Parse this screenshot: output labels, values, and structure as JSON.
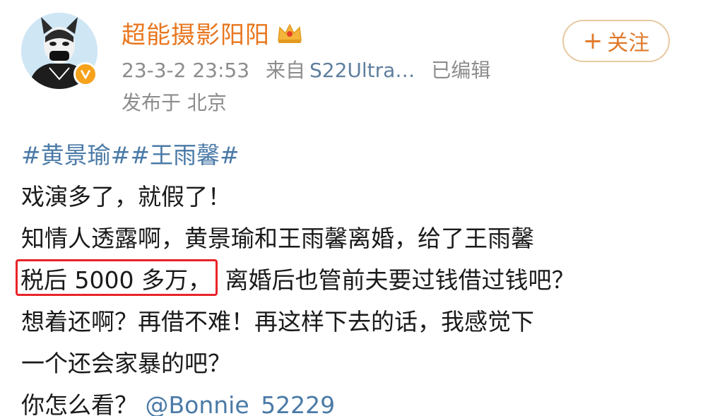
{
  "author": {
    "name": "超能摄影阳阳",
    "avatar_icon": "husky-mask-avatar",
    "verified_icon": "verified-v-badge-icon",
    "vip_icon": "crown-icon"
  },
  "meta": {
    "date": "23-3-2 23:53",
    "source_prefix": "来自",
    "source_name": "S22Ultra…",
    "edited": "已编辑",
    "location": "发布于 北京"
  },
  "follow_button": {
    "plus": "+",
    "label": "关注"
  },
  "content": {
    "hashtag1": "#黄景瑜#",
    "hashtag2": "#王雨馨#",
    "line1": "戏演多了，就假了！",
    "line2": "知情人透露啊，黄景瑜和王雨馨离婚，给了王雨馨",
    "line3_highlight": "税后 5000 多万，",
    "line3_rest": "离婚后也管前夫要过钱借过钱吧？",
    "line4": "想着还啊？再借不难！再这样下去的话，我感觉下",
    "line5": "一个还会家暴的吧？",
    "line6_text": "你怎么看？",
    "mention": "@Bonnie_52229"
  },
  "colors": {
    "username": "#e8761e",
    "link": "#4a7aa7",
    "meta": "#8c8c8c",
    "highlight_border": "#e8242a"
  }
}
